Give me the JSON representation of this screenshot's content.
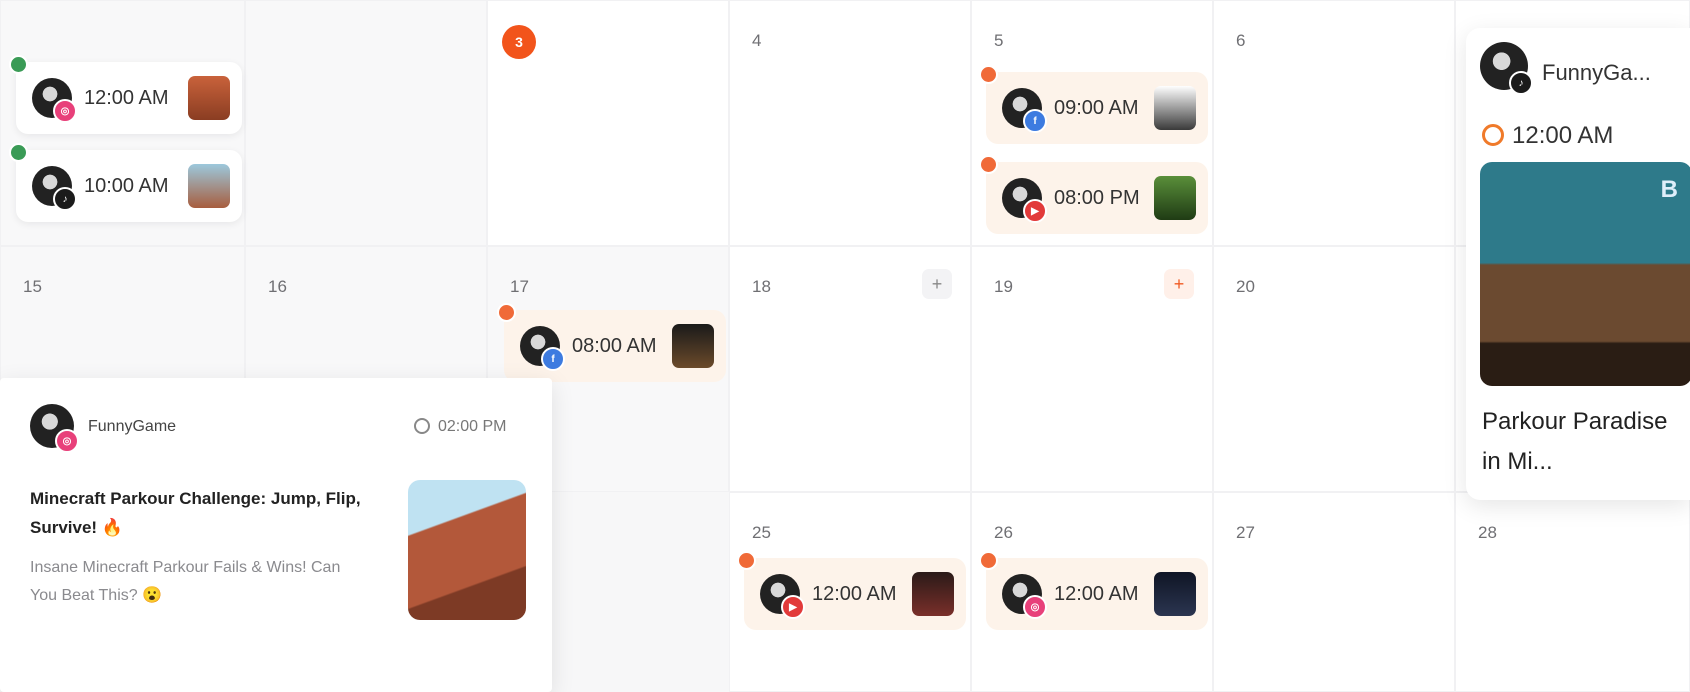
{
  "days": {
    "d3": "3",
    "d4": "4",
    "d5": "5",
    "d6": "6",
    "d15": "15",
    "d16": "16",
    "d17": "17",
    "d18": "18",
    "d19": "19",
    "d20": "20",
    "d25": "25",
    "d26": "26",
    "d27": "27",
    "d28": "28"
  },
  "add_label": "+",
  "events": {
    "ev1": {
      "time": "12:00 AM"
    },
    "ev2": {
      "time": "10:00 AM"
    },
    "ev3": {
      "time": "09:00 AM"
    },
    "ev4": {
      "time": "08:00 PM"
    },
    "ev5": {
      "time": "08:00 AM"
    },
    "ev6": {
      "time": "12:00 AM"
    },
    "ev7": {
      "time": "12:00 AM"
    }
  },
  "popup_left": {
    "author": "FunnyGame",
    "time": "02:00 PM",
    "title": "Minecraft Parkour Challenge: Jump, Flip, Survive! 🔥",
    "description": "Insane Minecraft Parkour Fails & Wins! Can You Beat This? 😮"
  },
  "popup_right": {
    "author": "FunnyGa...",
    "time": "12:00 AM",
    "title": "Parkour Paradise in Mi...",
    "thumb_mark": "B"
  },
  "colors": {
    "today": "#f2541b",
    "status_scheduled": "#f06a38",
    "status_published": "#3a9b56",
    "event_bg": "#fdf3ea"
  },
  "icons": [
    "clock-icon",
    "plus-icon",
    "instagram-badge-icon",
    "facebook-badge-icon",
    "youtube-badge-icon",
    "tiktok-badge-icon"
  ]
}
